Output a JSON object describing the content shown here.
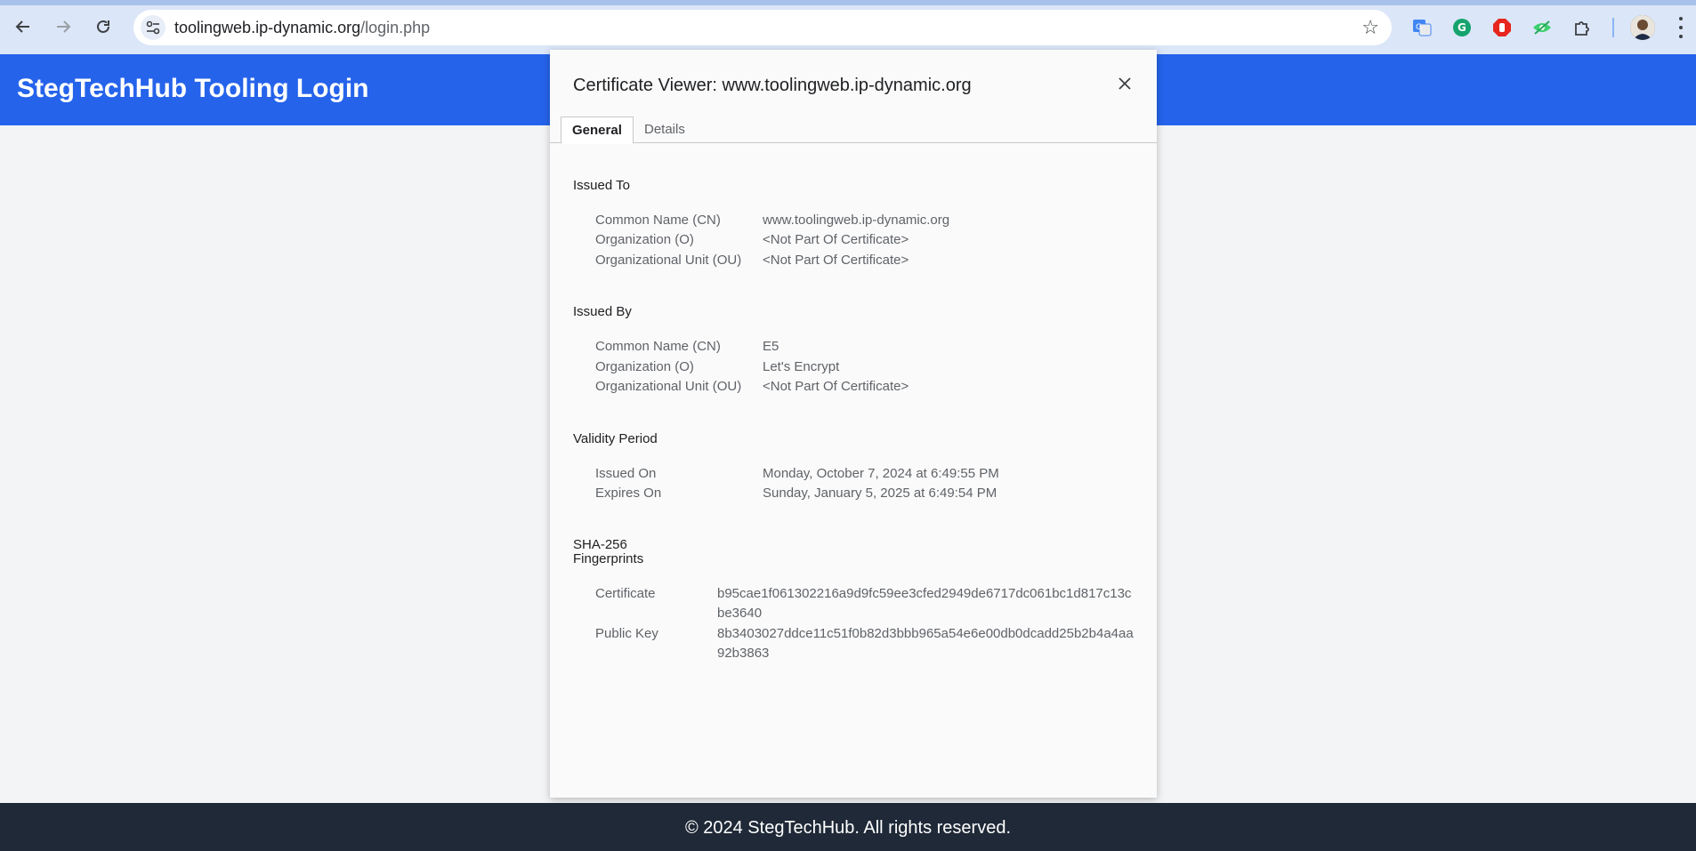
{
  "browser": {
    "url_host": "toolingweb.ip-dynamic.org",
    "url_path": "/login.php",
    "icons": [
      "back-arrow-icon",
      "forward-arrow-icon",
      "reload-icon",
      "site-settings-icon",
      "bookmark-star-icon",
      "google-translate-icon",
      "grammarly-icon",
      "adblock-icon",
      "eye-extension-icon",
      "extensions-puzzle-icon",
      "profile-avatar-icon",
      "more-menu-icon"
    ]
  },
  "page": {
    "title": "StegTechHub Tooling Login",
    "footer": "© 2024 StegTechHub. All rights reserved.",
    "header_color": "#2563eb",
    "footer_color": "#1f2937"
  },
  "dialog": {
    "title": "Certificate Viewer: www.toolingweb.ip-dynamic.org",
    "tabs": [
      "General",
      "Details"
    ],
    "active_tab": "General",
    "issued_to": {
      "heading": "Issued To",
      "rows": [
        {
          "label": "Common Name (CN)",
          "value": "www.toolingweb.ip-dynamic.org"
        },
        {
          "label": "Organization (O)",
          "value": "<Not Part Of Certificate>"
        },
        {
          "label": "Organizational Unit (OU)",
          "value": "<Not Part Of Certificate>"
        }
      ]
    },
    "issued_by": {
      "heading": "Issued By",
      "rows": [
        {
          "label": "Common Name (CN)",
          "value": "E5"
        },
        {
          "label": "Organization (O)",
          "value": "Let's Encrypt"
        },
        {
          "label": "Organizational Unit (OU)",
          "value": "<Not Part Of Certificate>"
        }
      ]
    },
    "validity": {
      "heading": "Validity Period",
      "rows": [
        {
          "label": "Issued On",
          "value": "Monday, October 7, 2024 at 6:49:55 PM"
        },
        {
          "label": "Expires On",
          "value": "Sunday, January 5, 2025 at 6:49:54 PM"
        }
      ]
    },
    "fingerprints": {
      "heading_line1": "SHA-256",
      "heading_line2": "Fingerprints",
      "rows": [
        {
          "label": "Certificate",
          "value": "b95cae1f061302216a9d9fc59ee3cfed2949de6717dc061bc1d817c13cbe3640"
        },
        {
          "label": "Public Key",
          "value": "8b3403027ddce11c51f0b82d3bbb965a54e6e00db0dcadd25b2b4a4aa92b3863"
        }
      ]
    }
  }
}
